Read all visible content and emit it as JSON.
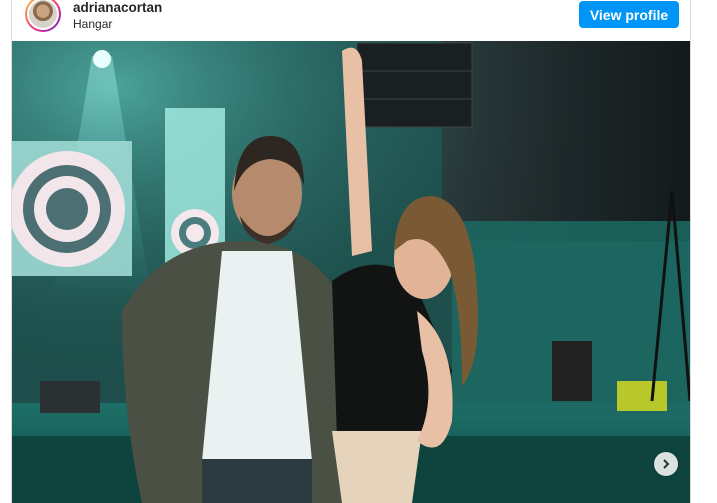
{
  "post": {
    "username": "adrianacortan",
    "location": "Hangar",
    "view_profile_label": "View profile"
  },
  "photo": {
    "icon": "carousel-next-icon"
  }
}
